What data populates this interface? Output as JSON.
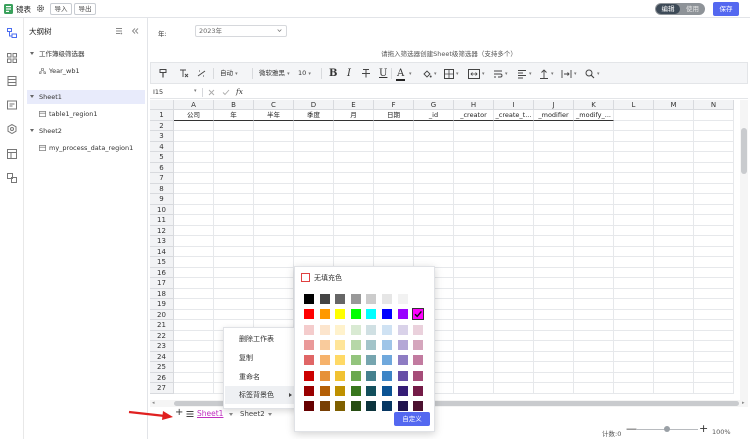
{
  "topbar": {
    "app_title": "镜表",
    "import_label": "导入",
    "export_label": "导出",
    "mode_edit": "编辑",
    "mode_use": "使用",
    "save_label": "保存",
    "accent_color": "#5468f0"
  },
  "rail_icons": [
    "outline-icon",
    "grid-apps-icon",
    "sheet-icon",
    "field-icon",
    "hexagon-icon",
    "table-icon",
    "layers-icon"
  ],
  "outline": {
    "title": "大纲树",
    "items": [
      {
        "label": "工作簿级筛选器",
        "kind": "group"
      },
      {
        "label": "Year_wb1",
        "kind": "filter"
      },
      {
        "label": "Sheet1",
        "kind": "group",
        "selected": true
      },
      {
        "label": "table1_region1",
        "kind": "table"
      },
      {
        "label": "Sheet2",
        "kind": "group"
      },
      {
        "label": "my_process_data_region1",
        "kind": "table"
      }
    ]
  },
  "filterbar": {
    "year_label": "年:",
    "year_value": "2023年",
    "hint": "请拖入筛选器创建Sheet级筛选器（支持多个）"
  },
  "toolbar": {
    "auto_label": "自动",
    "font_name": "微软雅黑",
    "font_size": "10",
    "bold": "B",
    "italic": "I",
    "underline": "U",
    "font_color_letter": "A"
  },
  "formula_bar": {
    "cell_ref": "I15",
    "fx": "fx"
  },
  "grid": {
    "columns": [
      "A",
      "B",
      "C",
      "D",
      "E",
      "F",
      "G",
      "H",
      "I",
      "J",
      "K",
      "L",
      "M",
      "N"
    ],
    "rows": [
      "1",
      "2",
      "3",
      "4",
      "5",
      "6",
      "7",
      "8",
      "9",
      "10",
      "11",
      "12",
      "13",
      "14",
      "15",
      "16",
      "17",
      "18",
      "19",
      "20",
      "21",
      "22",
      "23",
      "24",
      "25",
      "26",
      "27"
    ],
    "header_row": [
      "公司",
      "年",
      "半年",
      "季度",
      "月",
      "日期",
      "_id",
      "_creator",
      "_create_t...",
      "_modifier",
      "_modify_..."
    ]
  },
  "sheets": {
    "add": "+",
    "active": "Sheet1",
    "other": "Sheet2",
    "active_color": "#c030c0"
  },
  "status": {
    "count_label": "计数:0",
    "zoom_minus": "—",
    "zoom_plus": "+",
    "zoom_value": "100%"
  },
  "context_menu": {
    "items": [
      "删除工作表",
      "复制",
      "重命名",
      "标签背景色"
    ],
    "highlighted_index": 3
  },
  "palette": {
    "no_fill_label": "无填充色",
    "custom_label": "自定义",
    "selected_color": "#ff00ff",
    "rows": [
      [
        "#000000",
        "#444444",
        "#666666",
        "#999999",
        "#cccccc",
        "#e6e6e6",
        "#f2f2f2",
        "#ffffff"
      ],
      [
        "#ff0000",
        "#ff9900",
        "#ffff00",
        "#00ff00",
        "#00ffff",
        "#0000ff",
        "#9900ff",
        "#ff00ff"
      ],
      [
        "#f4cccc",
        "#fce5cd",
        "#fff2cc",
        "#d9ead3",
        "#d0e0e3",
        "#cfe2f3",
        "#d9d2e9",
        "#ead1dc"
      ],
      [
        "#ea9999",
        "#f9cb9c",
        "#ffe599",
        "#b6d7a8",
        "#a2c4c9",
        "#9fc5e8",
        "#b4a7d6",
        "#d5a6bd"
      ],
      [
        "#e06666",
        "#f6b26b",
        "#ffd966",
        "#93c47d",
        "#76a5af",
        "#6fa8dc",
        "#8e7cc3",
        "#c27ba0"
      ],
      [
        "#cc0000",
        "#e69138",
        "#f1c232",
        "#6aa84f",
        "#45818e",
        "#3d85c6",
        "#674ea7",
        "#a64d79"
      ],
      [
        "#990000",
        "#b45f06",
        "#bf9000",
        "#38761d",
        "#134f5c",
        "#0b5394",
        "#351c75",
        "#741b47"
      ],
      [
        "#660000",
        "#783f04",
        "#7f6000",
        "#274e13",
        "#0c343d",
        "#073763",
        "#20124d",
        "#4c1130"
      ]
    ]
  }
}
